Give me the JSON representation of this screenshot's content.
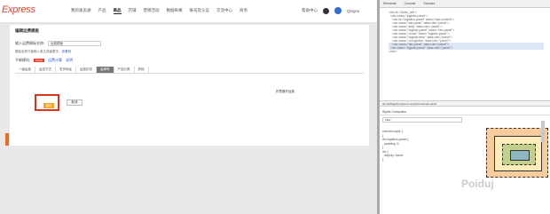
{
  "header": {
    "logo": "Express",
    "nav": [
      "我的速卖通",
      "产品",
      "商品",
      "店铺",
      "营销活动",
      "数据纵横",
      "账号及认证",
      "交流中心",
      "商务"
    ],
    "tools": [
      "帮助中心",
      "Qingsu"
    ]
  },
  "panel": {
    "title": "编辑运费模板",
    "template_label": "输入运费模板名称:",
    "template_value": "运费模板",
    "note": "模板名称只能输入英文或者数字，",
    "note_link": "查看例",
    "ship_label": "平邮模块:",
    "ship_tag": "China",
    "ship_links": [
      "运费计算",
      "说明"
    ],
    "tabs": [
      "一级运费",
      "运送方式",
      "发货地址",
      "运费折扣",
      "运单号",
      "产品分类",
      "其他"
    ],
    "active_tab": 4,
    "right_link": "折叠展开运费",
    "ok": "保存",
    "cancel": "取消"
  },
  "devtools": {
    "tabs": [
      "Elements",
      "Console",
      "Sources"
    ],
    "code": [
      "<div id=\"slider_tab\">",
      "  <div class=\"logistic-panel\">",
      "    <div id=\"logistics-panel\" class=\"tab-content\">",
      "    <div class=\"tab-panel\" data-role=\"panel\">",
      "    <div class=\"step\" data-role=\"panel\">",
      "    <div class=\"logistic-panel\" class=\"tab-panel\">",
      "    <div class=\"ui-tab\" class=\"logistic-panel\">",
      "    <div class=\"logistic-item\" data-role=\"panel\">",
      "    <div class=\"ui-logistics\" data-role=\"panel\">",
      "    <div class=\"tab-panel\" data-role=\"panel\">",
      "  <div class=\"logistic-panel\" data-role=\"panel\">",
      "</div>"
    ],
    "breadcrumb": "div  div#logistic-panel.ui-logistics-tab.tab-panel",
    "ctabs": [
      "Styles",
      "Computed"
    ],
    "filter": "Filter",
    "styles": [
      "element.style {",
      "}",
      "",
      "div.logistics-panel {",
      "  padding: 0;",
      "}",
      "",
      "div {",
      "  display: block;",
      "}"
    ],
    "watermark": "Poiduj"
  }
}
